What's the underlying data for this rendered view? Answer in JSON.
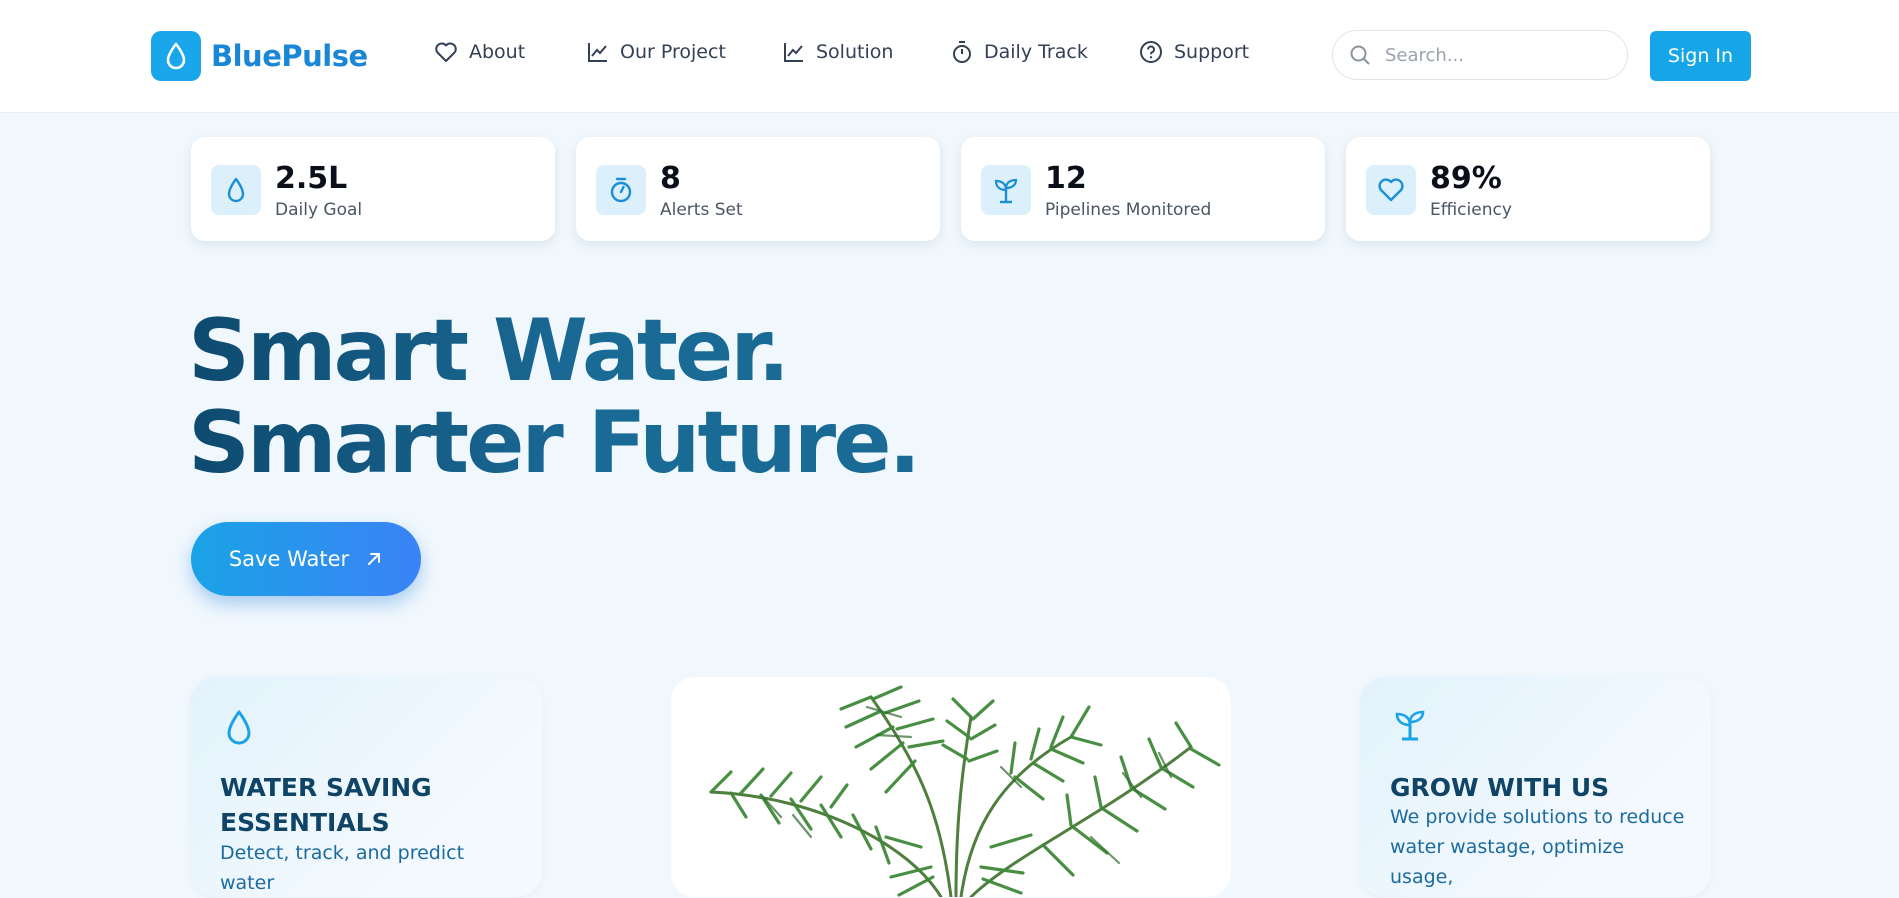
{
  "brand": {
    "name": "BluePulse",
    "accent": "#1aa6ea",
    "text_color": "#1a86d6"
  },
  "nav": {
    "items": [
      {
        "label": "About",
        "icon": "heart-icon"
      },
      {
        "label": "Our Project",
        "icon": "chart-line-icon"
      },
      {
        "label": "Solution",
        "icon": "chart-line-icon"
      },
      {
        "label": "Daily Track",
        "icon": "stopwatch-icon"
      },
      {
        "label": "Support",
        "icon": "help-circle-icon"
      }
    ]
  },
  "search": {
    "placeholder": "Search...",
    "value": ""
  },
  "signin": {
    "label": "Sign In",
    "color": "#16a6e8"
  },
  "stats": [
    {
      "value": "2.5L",
      "label": "Daily Goal",
      "icon": "water-drop-icon"
    },
    {
      "value": "8",
      "label": "Alerts Set",
      "icon": "stopwatch-icon"
    },
    {
      "value": "12",
      "label": "Pipelines Monitored",
      "icon": "sprout-icon"
    },
    {
      "value": "89%",
      "label": "Efficiency",
      "icon": "heart-icon"
    }
  ],
  "hero": {
    "line1": "Smart Water.",
    "line2": "Smarter Future.",
    "cta_label": "Save Water",
    "cta_icon": "arrow-up-right-icon"
  },
  "cards": {
    "left": {
      "icon": "water-drop-icon",
      "title_line1": "WATER SAVING",
      "title_line2": "ESSENTIALS",
      "text": "Detect, track, and predict water"
    },
    "center": {
      "image": "palm-plant-photo"
    },
    "right": {
      "icon": "sprout-icon",
      "title": "GROW WITH US",
      "text_line1": "We provide solutions to reduce",
      "text_line2": "water wastage, optimize usage,"
    }
  }
}
